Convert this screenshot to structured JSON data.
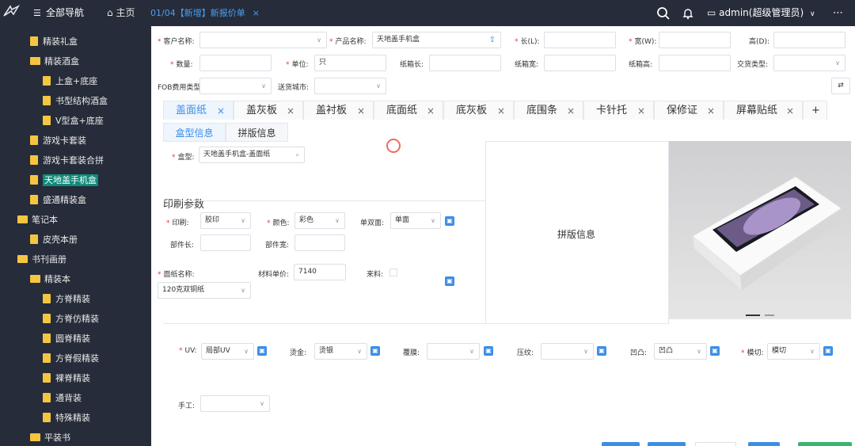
{
  "topbar": {
    "all_nav": "全部导航",
    "home": "主页",
    "active_tab": "01/04【新增】新报价单",
    "user": "admin(超级管理员)"
  },
  "sidebar": {
    "items": [
      {
        "label": "精装礼盒",
        "icon": "file-icon"
      },
      {
        "label": "精装酒盒",
        "icon": "folder-icon"
      },
      {
        "label": "上盒+底座",
        "icon": "file-icon"
      },
      {
        "label": "书型结构酒盒",
        "icon": "file-icon"
      },
      {
        "label": "V型盒+底座",
        "icon": "file-icon"
      },
      {
        "label": "游戏卡套装",
        "icon": "file-icon"
      },
      {
        "label": "游戏卡套装合拼",
        "icon": "file-icon"
      },
      {
        "label": "天地盖手机盒",
        "icon": "file-icon",
        "selected": true
      },
      {
        "label": "盛通精装盒",
        "icon": "file-icon"
      },
      {
        "label": "笔记本",
        "icon": "folder-icon"
      },
      {
        "label": "皮壳本册",
        "icon": "file-icon"
      },
      {
        "label": "书刊画册",
        "icon": "folder-icon"
      },
      {
        "label": "精装本",
        "icon": "folder-icon"
      },
      {
        "label": "方脊精装",
        "icon": "file-icon"
      },
      {
        "label": "方脊仿精装",
        "icon": "file-icon"
      },
      {
        "label": "圆脊精装",
        "icon": "file-icon"
      },
      {
        "label": "方脊假精装",
        "icon": "file-icon"
      },
      {
        "label": "裸脊精装",
        "icon": "file-icon"
      },
      {
        "label": "通背装",
        "icon": "file-icon"
      },
      {
        "label": "特殊精装",
        "icon": "file-icon"
      },
      {
        "label": "平装书",
        "icon": "folder-icon"
      }
    ]
  },
  "form": {
    "customer_label": "客户名称:",
    "product_label": "产品名称:",
    "product_value": "天地盖手机盒",
    "length_label": "长(L):",
    "width_label": "宽(W):",
    "height_label": "高(D):",
    "qty_label": "数量:",
    "unit_label": "单位:",
    "unit_value": "只",
    "carton_len_label": "纸箱长:",
    "carton_w_label": "纸箱宽:",
    "carton_h_label": "纸箱高:",
    "trade_label": "交货类型:",
    "fob_label": "FOB费用类型",
    "city_label": "送货城市:"
  },
  "part_tabs": [
    "盖面纸",
    "盖灰板",
    "盖衬板",
    "底面纸",
    "底灰板",
    "底围条",
    "卡针托",
    "保修证",
    "屏幕贴纸"
  ],
  "sub_tabs": [
    "盒型信息",
    "拼版信息"
  ],
  "box": {
    "box_label": "盒型:",
    "box_value": "天地盖手机盒-盖面纸"
  },
  "print": {
    "section_title": "印刷参数",
    "print_label": "印刷:",
    "print_value": "胶印",
    "color_label": "颜色:",
    "color_value": "彩色",
    "side_label": "单双面:",
    "side_value": "单面",
    "part_len_label": "部件长:",
    "part_w_label": "部件宽:",
    "paper_label": "面纸名称:",
    "paper_value": "120克双铜纸",
    "price_label": "材料单价:",
    "price_value": "7140",
    "material_label": "来料:",
    "uv_label": "UV:",
    "uv_value": "局部UV",
    "gild_label": "烫金:",
    "gild_value": "烫银",
    "film_label": "覆膜:",
    "press_label": "压纹:",
    "emboss_label": "凹凸:",
    "emboss_value": "凹凸",
    "die_label": "模切:",
    "die_value": "模切",
    "hand_label": "手工:"
  },
  "panel": {
    "title": "拼版信息"
  },
  "colors": {
    "sidebar_bg": "#262c39",
    "accent": "#3b8ee6",
    "selected_bg": "#0f8a7b",
    "required": "#e4393c"
  }
}
